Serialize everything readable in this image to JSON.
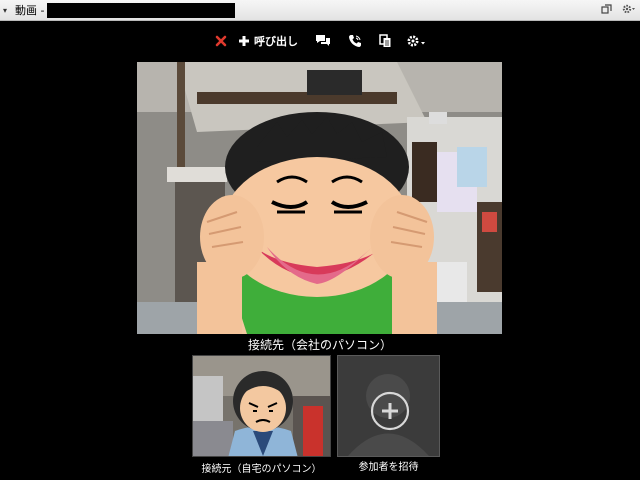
{
  "window": {
    "title": "動画 -",
    "menu_glyph": "▾"
  },
  "toolbar": {
    "call_label": "呼び出し",
    "hangup_color": "#e03a2e"
  },
  "main_video": {
    "label": "接続先（会社のパソコン）"
  },
  "participants": [
    {
      "label": "接続元（自宅のパソコン）"
    }
  ],
  "invite": {
    "label": "参加者を招待"
  },
  "icons": {
    "hangup": "close-icon",
    "call": "plus-icon",
    "chat": "chat-bubbles-icon",
    "phone": "phone-icon",
    "copy": "copy-document-icon",
    "settings": "gear-icon",
    "restore": "restore-window-icon",
    "window_settings": "gear-icon",
    "invite": "add-person-icon"
  }
}
